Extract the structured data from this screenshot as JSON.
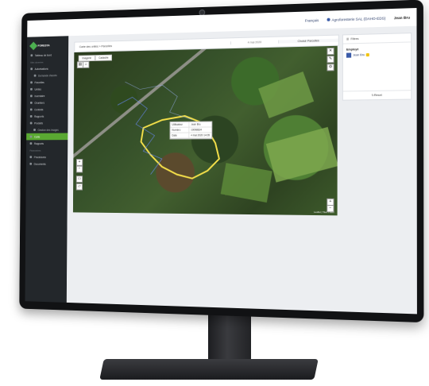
{
  "topbar": {
    "language": "Français",
    "organization": "Agroforesterie SAL (DAHO-EDS)",
    "user": "Jean Bru"
  },
  "sidebar": {
    "logo_text": "FORESTA",
    "items": [
      {
        "label": "Tableau de bord",
        "type": "item"
      },
      {
        "label": "Mes données",
        "type": "section"
      },
      {
        "label": "Autorisations",
        "type": "item"
      },
      {
        "label": "Demande d'accès",
        "type": "sub"
      },
      {
        "label": "Parcelles",
        "type": "item"
      },
      {
        "label": "Unités",
        "type": "item"
      },
      {
        "label": "Inventaire",
        "type": "item"
      },
      {
        "label": "Chantiers",
        "type": "item"
      },
      {
        "label": "Contrats",
        "type": "item"
      },
      {
        "label": "Rapports",
        "type": "item"
      },
      {
        "label": "Produits",
        "type": "item"
      },
      {
        "label": "Gestion des images",
        "type": "sub"
      },
      {
        "label": "Carte",
        "type": "active"
      },
      {
        "label": "Rapports",
        "type": "item"
      },
      {
        "label": "Paramètres",
        "type": "section"
      },
      {
        "label": "Procédures",
        "type": "item"
      },
      {
        "label": "Documents",
        "type": "item"
      }
    ]
  },
  "toolbar": {
    "breadcrumb": "Carte des unités > Parcelles",
    "date_filter": "4 mai 2020",
    "all_button": "Choisir Parcelles"
  },
  "map": {
    "tabs": [
      "Imagerie",
      "Cadastre"
    ],
    "popup": [
      {
        "key": "Utilisateur",
        "value": "Jean Bru"
      },
      {
        "key": "Numéro",
        "value": "10098624"
      },
      {
        "key": "Date",
        "value": "4 mai 2020 14:05"
      }
    ],
    "attribution": "Leaflet | Tiles © Esri"
  },
  "panel": {
    "header": "Filtres",
    "title": "Employé",
    "item_label": "Jean Bru",
    "reset_label": "Reset"
  }
}
